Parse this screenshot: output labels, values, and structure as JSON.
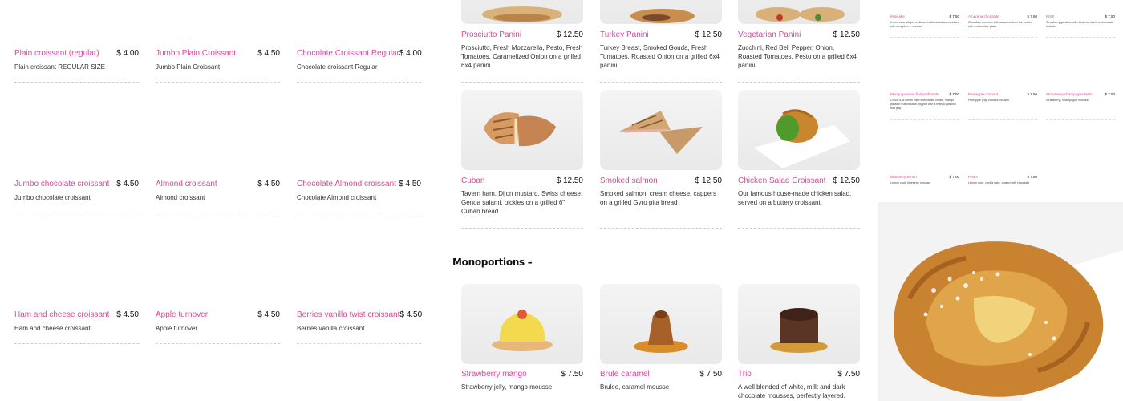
{
  "croissants": [
    {
      "name": "Plain croissant (regular)",
      "price": "$ 4.00",
      "desc": "Plain croissant REGULAR SIZE"
    },
    {
      "name": "Jumbo Plain Croissant",
      "price": "$ 4.50",
      "desc": "Jumbo Plain Croissant"
    },
    {
      "name": "Chocolate Croissant Regular",
      "price": "$ 4.00",
      "desc": "Chocolate croissant Regular"
    },
    {
      "name": "Jumbo chocolate croissant",
      "price": "$ 4.50",
      "desc": "Jumbo chocolate croissant"
    },
    {
      "name": "Almond croissant",
      "price": "$ 4.50",
      "desc": "Almond croissant"
    },
    {
      "name": "Chocolate Almond croissant",
      "price": "$ 4.50",
      "desc": "Chocolate Almond croissant"
    },
    {
      "name": "Ham and cheese croissant",
      "price": "$ 4.50",
      "desc": "Ham and cheese croissant"
    },
    {
      "name": "Apple turnover",
      "price": "$ 4.50",
      "desc": "Apple turnover"
    },
    {
      "name": "Berries vanilla twist croissant",
      "price": "$ 4.50",
      "desc": "Berries vanilla croissant"
    }
  ],
  "paninis": [
    {
      "name": "Prosciutto Panini",
      "price": "$ 12.50",
      "desc": "Prosciutto, Fresh Mozzarella, Pesto, Fresh Tomatoes, Caramelized Onion on a grilled 6x4 panini"
    },
    {
      "name": "Turkey Panini",
      "price": "$ 12.50",
      "desc": "Turkey Breast, Smoked Gouda, Fresh Tomatoes, Roasted Onion on a grilled 6x4 panini"
    },
    {
      "name": "Vegetarian Panini",
      "price": "$ 12.50",
      "desc": "Zucchini, Red Bell Pepper, Onion, Roasted Tomatoes, Pesto on a grilled 6x4 panini"
    },
    {
      "name": "Cuban",
      "price": "$ 12.50",
      "desc": "Tavern ham, Dijon mustard, Swiss cheese, Genoa salami, pickles on a grilled 6\" Cuban bread"
    },
    {
      "name": "Smoked salmon",
      "price": "$ 12.50",
      "desc": "Smoked salmon, cream cheese, cappers on a grilled Gyro pita bread"
    },
    {
      "name": "Chicken Salad Croissant",
      "price": "$ 12.50",
      "desc": "Our famous house-made chicken salad, served on a buttery croissant."
    }
  ],
  "monoportions": {
    "title": "Monoportions –",
    "items": [
      {
        "name": "Strawberry mango",
        "price": "$ 7.50",
        "desc": "Strawberry jelly, mango mousse"
      },
      {
        "name": "Brule caramel",
        "price": "$ 7.50",
        "desc": "Brulee, caramel mousse"
      },
      {
        "name": "Trio",
        "price": "$ 7.50",
        "desc": "A well blended of white, milk and dark chocolate mousses, perfectly layered."
      }
    ]
  },
  "mini_menu": [
    {
      "name": "Minicake",
      "price": "$ 7.50",
      "desc": "A mini cake shape; white and milk chocolate mousses with a raspberry mousse."
    },
    {
      "name": "Amarena chocolate",
      "price": "$ 7.50",
      "desc": "Chocolate cremeux with amarena cherries, coated with a chocolate glaze."
    },
    {
      "name": "KISS",
      "price": "$ 7.50",
      "desc": "Strawberry ganache with fresh berries in a chocolate foulade."
    },
    {
      "name": "Mango passion fruit profiterole",
      "price": "$ 7.50",
      "desc": "Choux a la creme filled with vanilla cream, mango passion fruit mousse, topped with a mango passion fruit jelly"
    },
    {
      "name": "Pineapple coconut",
      "price": "$ 7.50",
      "desc": "Pineapple jelly, coconut mousse"
    },
    {
      "name": "Strawberry champagne twist",
      "price": "$ 7.50",
      "desc": "Strawberry / champagne mousse"
    },
    {
      "name": "Blueberry lemon",
      "price": "$ 7.00",
      "desc": "Lemon curd, blueberry mousse"
    },
    {
      "name": "Pears",
      "price": "$ 7.50",
      "desc": "Lemon curd, vanilla cake, coated with chocolate"
    }
  ],
  "colors": {
    "accent": "#d9489a",
    "rule": "#cfcfcf"
  }
}
